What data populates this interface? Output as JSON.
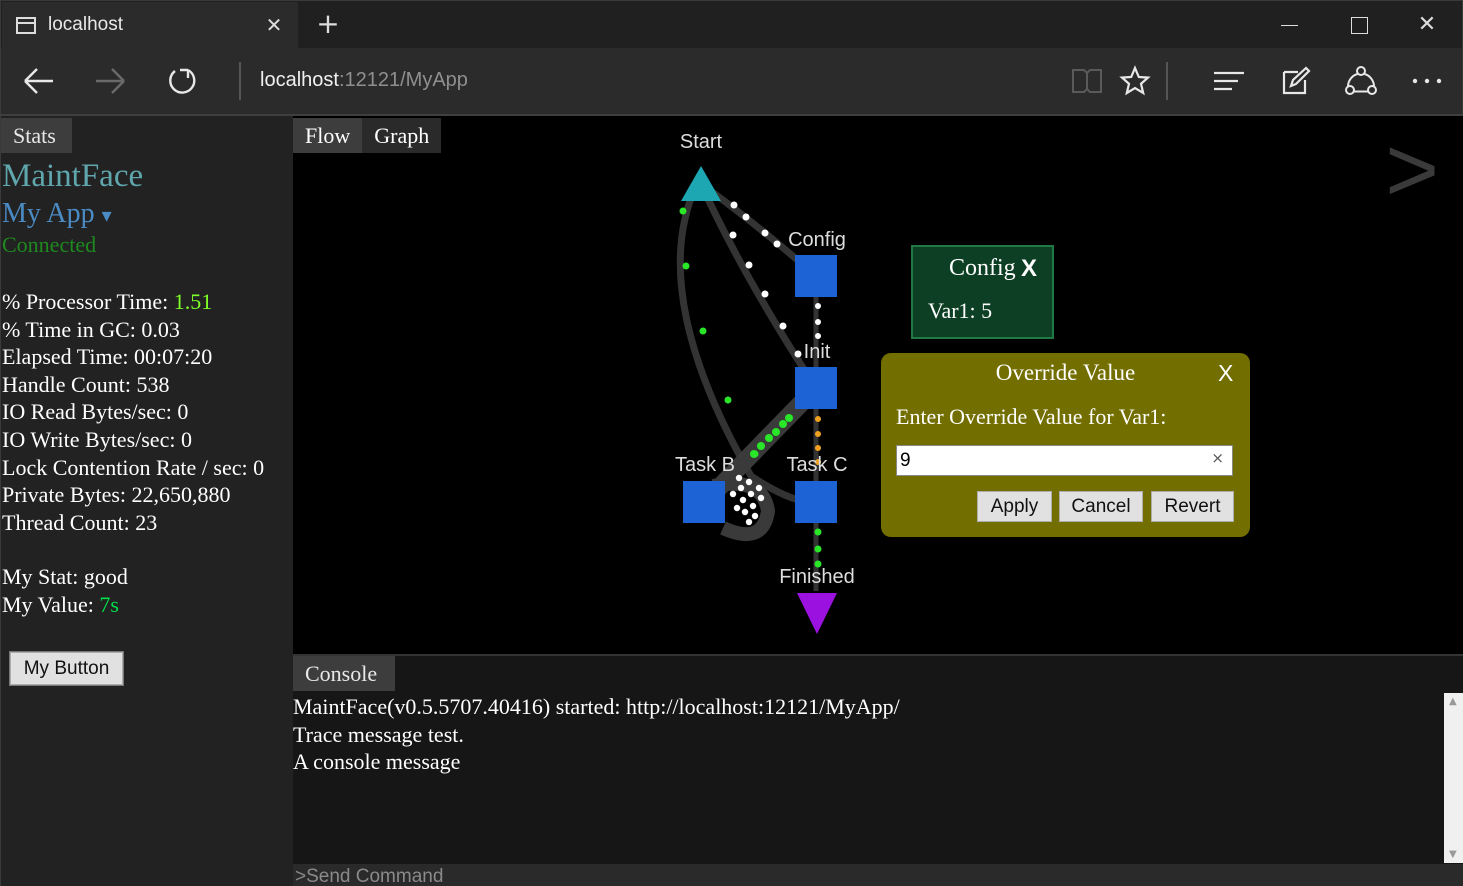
{
  "browser": {
    "tab_title": "localhost",
    "address_host": "localhost",
    "address_path": ":12121/MyApp"
  },
  "stats": {
    "tab_label": "Stats",
    "app_title": "MaintFace",
    "app_selector": "My App",
    "connection_status": "Connected",
    "counters": [
      {
        "label": "% Processor Time: ",
        "value": "1.51"
      },
      {
        "label": "% Time in GC: ",
        "value": "0.03"
      },
      {
        "label": "Elapsed Time: ",
        "value": "00:07:20"
      },
      {
        "label": "Handle Count: ",
        "value": "538"
      },
      {
        "label": "IO Read Bytes/sec: ",
        "value": "0"
      },
      {
        "label": "IO Write Bytes/sec: ",
        "value": "0"
      },
      {
        "label": "Lock Contention Rate / sec: ",
        "value": "0"
      },
      {
        "label": "Private Bytes: ",
        "value": "22,650,880"
      },
      {
        "label": "Thread Count: ",
        "value": "23"
      }
    ],
    "custom": [
      {
        "label": "My Stat: ",
        "value": "good"
      },
      {
        "label": "My Value: ",
        "value": "7s"
      }
    ],
    "button_label": "My Button"
  },
  "flow": {
    "tabs": [
      "Flow",
      "Graph"
    ],
    "next_glyph": ">",
    "nodes": {
      "start": "Start",
      "config": "Config",
      "init": "Init",
      "task_b": "Task B",
      "task_c": "Task C",
      "finished": "Finished"
    }
  },
  "config_box": {
    "title": "Config",
    "close": "X",
    "var_label": "Var1: ",
    "var_value": "5"
  },
  "override_dialog": {
    "title": "Override Value",
    "close": "X",
    "prompt": "Enter Override Value for Var1:",
    "input_value": "9",
    "clear_glyph": "×",
    "apply": "Apply",
    "cancel": "Cancel",
    "revert": "Revert"
  },
  "console": {
    "tab_label": "Console",
    "lines": [
      "MaintFace(v0.5.5707.40416) started: http://localhost:12121/MyApp/",
      "Trace message test.",
      "A console message"
    ],
    "command_placeholder": ">Send Command"
  },
  "colors": {
    "accent_teal": "#5fa6ad",
    "app_blue": "#4b8bc4",
    "connected_green": "#1e8a1e",
    "value_green": "#7fff2a",
    "node_blue": "#1e63d6",
    "start_teal": "#1ca7b3",
    "finished_purple": "#9b12e0",
    "dialog_olive": "#736e00",
    "config_green": "#0d3f24"
  }
}
